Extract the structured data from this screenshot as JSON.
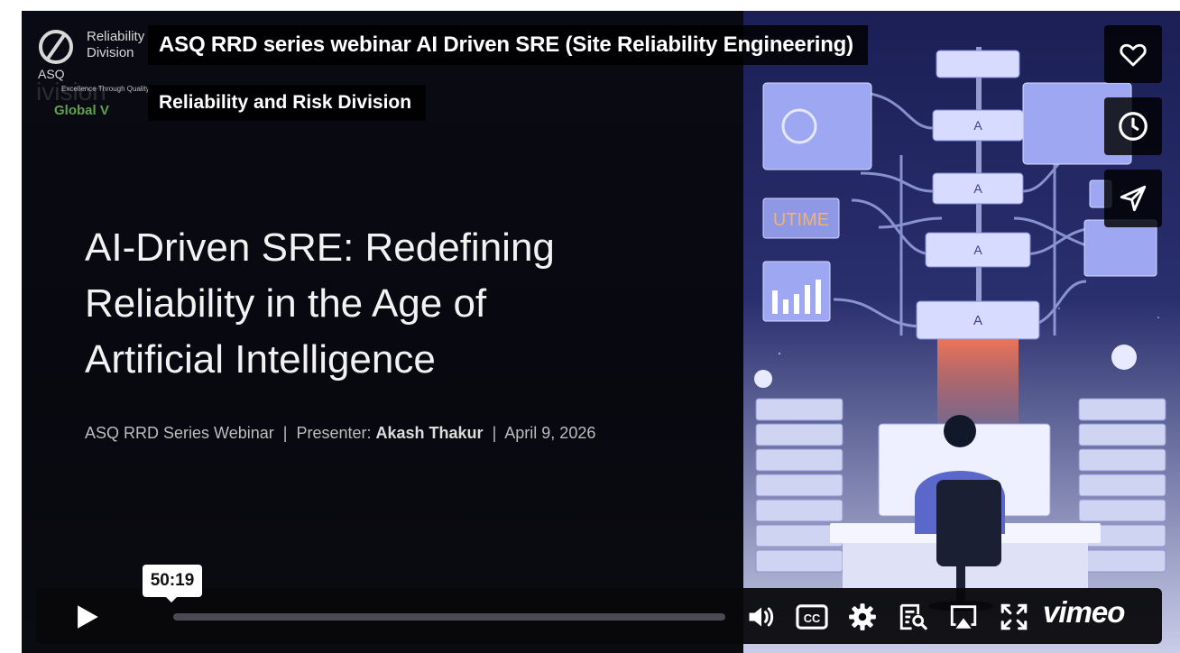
{
  "video": {
    "title": "ASQ RRD series webinar AI Driven SRE (Site Reliability Engineering)",
    "byline": "Reliability and Risk Division"
  },
  "slide": {
    "logo_line1": "Reliability",
    "logo_line2": "Division",
    "logo_asq": "ASQ",
    "logo_tagline": "Excellence Through Quality",
    "logo_global": "Global V",
    "logo_ghost": "ivision",
    "heading_line1": "AI-Driven SRE: Redefining",
    "heading_line2": "Reliability in the Age of",
    "heading_line3": "Artificial Intelligence",
    "sub_series": "ASQ RRD Series Webinar",
    "sub_sep": "|",
    "sub_presenter_label": "Presenter:",
    "sub_presenter_name": "Akash Thakur",
    "sub_date": "April 9, 2026",
    "illus_uptime_label": "UTIME",
    "illus_node_letter": "A"
  },
  "side_buttons": [
    {
      "name": "like",
      "icon": "heart-icon"
    },
    {
      "name": "watch-later",
      "icon": "clock-icon"
    },
    {
      "name": "share",
      "icon": "paper-plane-icon"
    }
  ],
  "controls": {
    "hover_time": "50:19",
    "progress_fraction": 0.0,
    "brand": "vimeo",
    "icons": [
      "play-icon",
      "volume-icon",
      "cc-icon",
      "settings-icon",
      "transcript-icon",
      "airplay-icon",
      "fullscreen-icon"
    ]
  },
  "colors": {
    "background": "#07070f",
    "logo_green": "#5fa24e",
    "illus_blue": "#8a97e8",
    "illus_red": "#e06a52"
  }
}
